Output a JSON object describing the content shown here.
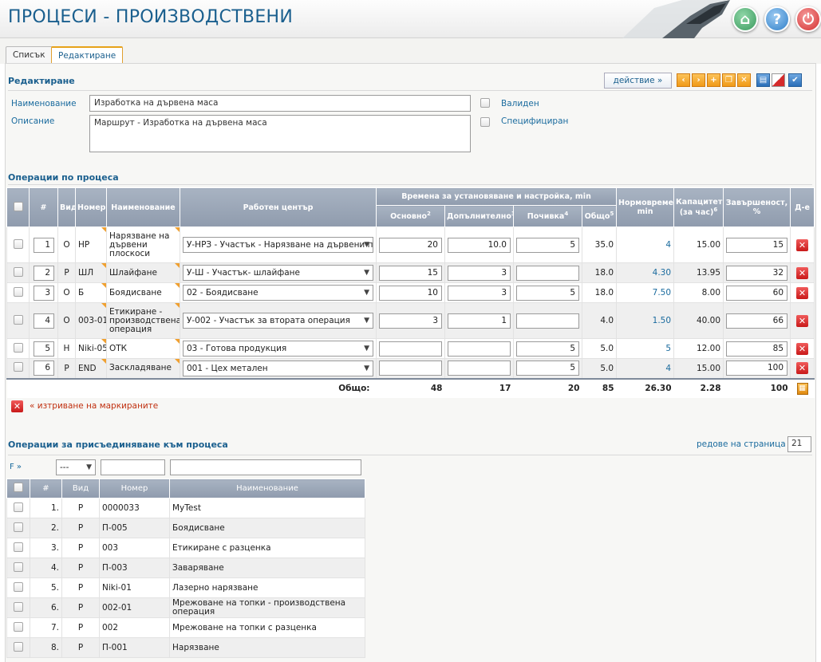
{
  "header": {
    "title": "ПРОЦЕСИ - ПРОИЗВОДСТВЕНИ",
    "home_icon": "home-icon",
    "help_label": "?",
    "power_icon": "power-icon"
  },
  "tabs": [
    {
      "label": "Списък"
    },
    {
      "label": "Редактиране"
    }
  ],
  "edit": {
    "section_title": "Редактиране",
    "action_label": "действие »",
    "name_label": "Наименование",
    "name_value": "Изработка на дървена маса",
    "desc_label": "Описание",
    "desc_value": "Маршрут - Изработка на дървена маса",
    "valid_label": "Валиден",
    "specified_label": "Специфициран",
    "toolbar_icons": [
      "prev-icon",
      "next-icon",
      "add-icon",
      "copy-icon",
      "delete-icon",
      "print-icon",
      "cancel-icon",
      "save-icon"
    ],
    "toolbar_glyphs": [
      "‹",
      "›",
      "+",
      "❐",
      "✕",
      "▤",
      "◢",
      "✔"
    ]
  },
  "ops": {
    "section_title": "Операции по процеса",
    "headers": {
      "num": "#",
      "type": "Вид",
      "code": "Номер",
      "name": "Наименование",
      "wc": "Работен център",
      "times_group": "Времена за установяване и настройка, min",
      "basic": "Основно",
      "basic_sup": "2",
      "additional": "Допълнително",
      "additional_sup": "3",
      "rest": "Почивка",
      "rest_sup": "4",
      "total": "Общо",
      "total_sup": "5",
      "norm": "Нормовреме, min",
      "capacity": "Капацитет (за час)",
      "capacity_sup": "6",
      "completion": "Завършеност, %",
      "delete": "Д-е"
    },
    "rows": [
      {
        "n": "1",
        "type": "О",
        "code": "НР",
        "name": "Нарязване на дървени плоскоси",
        "wc": "У-НРЗ - Участък - Нарязване на дървени пл",
        "basic": "20",
        "additional": "10.0",
        "rest": "5",
        "total": "35.0",
        "norm": "4",
        "capacity": "15.00",
        "completion": "15"
      },
      {
        "n": "2",
        "type": "Р",
        "code": "ШЛ",
        "name": "Шлайфане",
        "wc": "У-Ш - Участък- шлайфане",
        "basic": "15",
        "additional": "3",
        "rest": "",
        "total": "18.0",
        "norm": "4.30",
        "capacity": "13.95",
        "completion": "32"
      },
      {
        "n": "3",
        "type": "О",
        "code": "Б",
        "name": "Боядисване",
        "wc": "02 - Боядисване",
        "basic": "10",
        "additional": "3",
        "rest": "5",
        "total": "18.0",
        "norm": "7.50",
        "capacity": "8.00",
        "completion": "60"
      },
      {
        "n": "4",
        "type": "О",
        "code": "003-01",
        "name": "Етикиране - производствена операция",
        "wc": "У-002 - Участък за втората операция",
        "basic": "3",
        "additional": "1",
        "rest": "",
        "total": "4.0",
        "norm": "1.50",
        "capacity": "40.00",
        "completion": "66"
      },
      {
        "n": "5",
        "type": "Н",
        "code": "Niki-05",
        "name": "ОТК",
        "wc": "03 - Готова продукция",
        "basic": "",
        "additional": "",
        "rest": "5",
        "total": "5.0",
        "norm": "5",
        "capacity": "12.00",
        "completion": "85"
      },
      {
        "n": "6",
        "type": "Р",
        "code": "END",
        "name": "Заскладяване",
        "wc": "001 - Цех метален",
        "basic": "",
        "additional": "",
        "rest": "5",
        "total": "5.0",
        "norm": "4",
        "capacity": "15.00",
        "completion": "100"
      }
    ],
    "totals": {
      "label": "Общо:",
      "basic": "48",
      "additional": "17",
      "rest": "20",
      "total": "85",
      "norm": "26.30",
      "capacity": "2.28",
      "completion": "100"
    },
    "delete_marked": "« изтриване на маркираните"
  },
  "join": {
    "section_title": "Операции за присъединяване към процеса",
    "rows_per_page_label": "редове на страница »",
    "rows_per_page_value": "21",
    "filter_link": "F »",
    "filter_select": "---",
    "headers": {
      "num": "#",
      "type": "Вид",
      "code": "Номер",
      "name": "Наименование"
    },
    "rows": [
      {
        "n": "1.",
        "type": "Р",
        "code": "0000033",
        "name": "MyTest"
      },
      {
        "n": "2.",
        "type": "Р",
        "code": "П-005",
        "name": "Боядисване"
      },
      {
        "n": "3.",
        "type": "Р",
        "code": "003",
        "name": "Етикиране с разценка"
      },
      {
        "n": "4.",
        "type": "Р",
        "code": "П-003",
        "name": "Заваряване"
      },
      {
        "n": "5.",
        "type": "Р",
        "code": "Niki-01",
        "name": "Лазерно нарязване"
      },
      {
        "n": "6.",
        "type": "Р",
        "code": "002-01",
        "name": "Мрежоване на топки - производствена операция"
      },
      {
        "n": "7.",
        "type": "Р",
        "code": "002",
        "name": "Мрежоване на топки с разценка"
      },
      {
        "n": "8.",
        "type": "Р",
        "code": "П-001",
        "name": "Нарязване"
      }
    ]
  }
}
